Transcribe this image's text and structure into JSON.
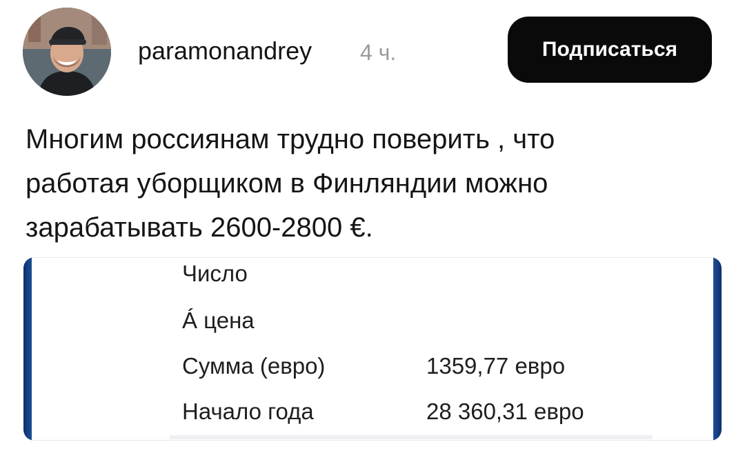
{
  "header": {
    "username": "paramonandrey",
    "timestamp": "4 ч.",
    "subscribe_label": "Подписаться"
  },
  "post": {
    "lines": [
      "Многим россиянам трудно поверить , что",
      "работая уборщиком в Финляндии можно",
      "зарабатывать 2600-2800 €."
    ]
  },
  "card": {
    "rows": [
      {
        "label": "Число",
        "value": ""
      },
      {
        "label": "Á цена",
        "value": ""
      },
      {
        "label": "Сумма (евро)",
        "value": "1359,77 евро"
      },
      {
        "label": "Начало года",
        "value": "28 360,31 евро"
      }
    ],
    "edge_color": "#153c7e"
  },
  "colors": {
    "button_bg": "#0a0a0a",
    "timestamp": "#9a9a9a"
  }
}
